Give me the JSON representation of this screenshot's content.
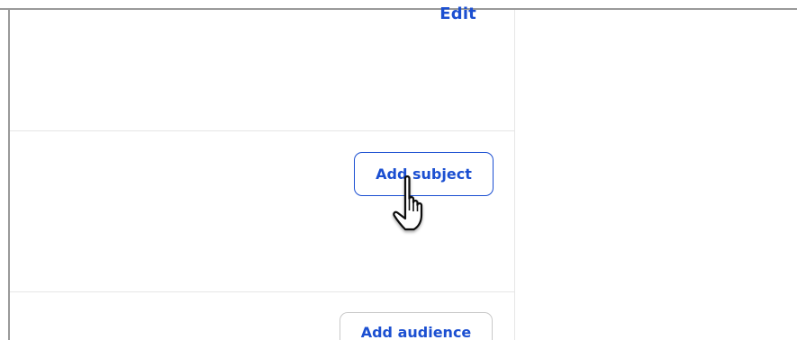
{
  "card": {
    "edit_label": "Edit",
    "add_subject_label": "Add subject",
    "add_audience_label": "Add audience"
  },
  "cursor": {
    "icon": "hand-pointer-icon"
  },
  "colors": {
    "accent": "#1b4fd1",
    "divider": "#e6e6e6",
    "frame": "#9a9a9a",
    "neutral_border": "#c9c9c9"
  }
}
